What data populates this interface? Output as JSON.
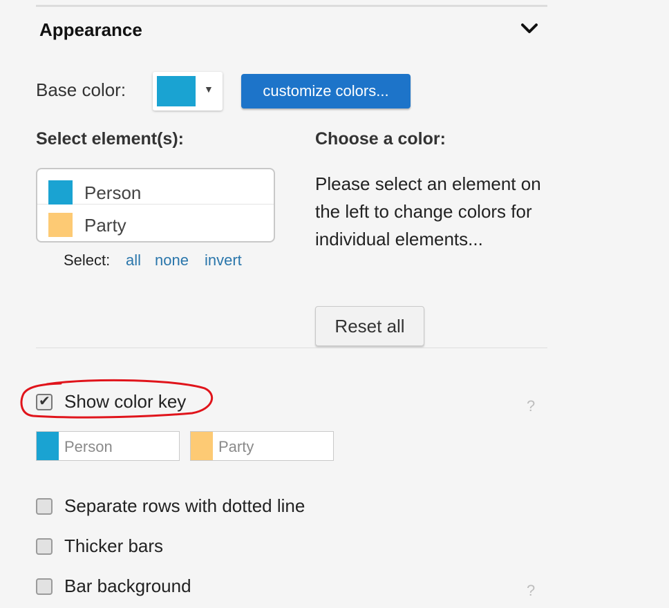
{
  "section": {
    "title": "Appearance",
    "toggle_icon": "chevron-down-icon"
  },
  "base_color": {
    "label": "Base color:",
    "value_color": "#1aa3d2",
    "customize_label": "customize colors..."
  },
  "elements": {
    "heading": "Select element(s):",
    "items": [
      {
        "label": "Person",
        "color": "#1aa3d2"
      },
      {
        "label": "Party",
        "color": "#fdca74"
      }
    ],
    "select_prefix": "Select:",
    "select_all": "all",
    "select_none": "none",
    "select_invert": "invert"
  },
  "choose": {
    "heading": "Choose a color:",
    "help_text": "Please select an element on the left to change colors for individual elements...",
    "reset_label": "Reset all"
  },
  "options": {
    "show_color_key": {
      "label": "Show color key",
      "checked": true
    },
    "color_key_fields": [
      {
        "placeholder": "Person",
        "color": "#1aa3d2"
      },
      {
        "placeholder": "Party",
        "color": "#fdca74"
      }
    ],
    "separate_rows": {
      "label": "Separate rows with dotted line",
      "checked": false
    },
    "thicker_bars": {
      "label": "Thicker bars",
      "checked": false
    },
    "bar_background": {
      "label": "Bar background",
      "checked": false
    },
    "help_mark": "?"
  },
  "colors": {
    "accent": "#1d74c9",
    "link": "#2a76ab",
    "annotation": "#e0141b"
  }
}
